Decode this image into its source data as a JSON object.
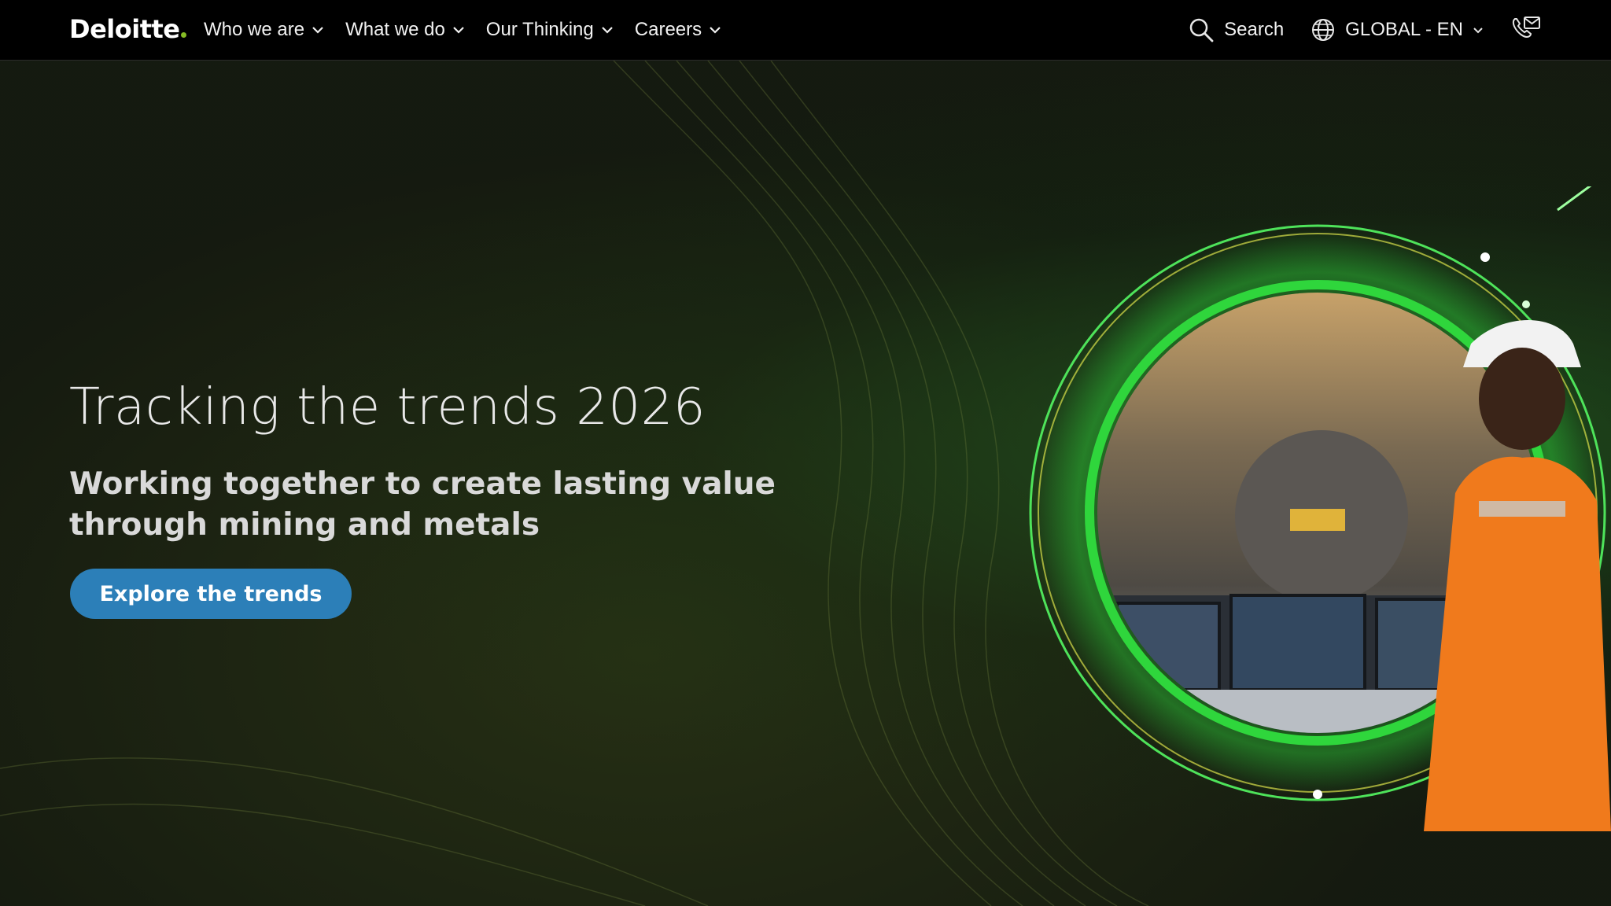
{
  "brand": {
    "logo_text": "Deloitte",
    "accent_color": "#86bc25"
  },
  "nav": {
    "items": [
      {
        "label": "Who we are"
      },
      {
        "label": "What we do"
      },
      {
        "label": "Our Thinking"
      },
      {
        "label": "Careers"
      }
    ],
    "search_label": "Search",
    "locale_label": "GLOBAL - EN"
  },
  "hero": {
    "title": "Tracking the trends 2026",
    "subtitle": "Working together to create lasting value through mining and metals",
    "cta_label": "Explore the trends",
    "cta_color": "#2c7fb8"
  }
}
